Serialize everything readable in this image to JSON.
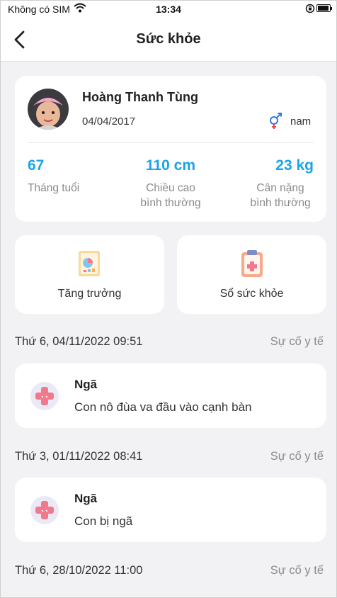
{
  "status_bar": {
    "carrier": "Không có SIM",
    "time": "13:34",
    "battery_level": 0.95
  },
  "header": {
    "title": "Sức khỏe"
  },
  "profile": {
    "name": "Hoàng Thanh Tùng",
    "dob": "04/04/2017",
    "gender": "nam",
    "stats": [
      {
        "value": "67",
        "label_line1": "Tháng tuổi",
        "label_line2": ""
      },
      {
        "value": "110 cm",
        "label_line1": "Chiều cao",
        "label_line2": "bình thường"
      },
      {
        "value": "23 kg",
        "label_line1": "Cân nặng",
        "label_line2": "bình thường"
      }
    ]
  },
  "quick_actions": [
    {
      "label": "Tăng trưởng",
      "icon": "growth-chart-icon"
    },
    {
      "label": "Sổ sức khỏe",
      "icon": "health-book-icon"
    }
  ],
  "events": [
    {
      "date": "Thứ 6, 04/11/2022 09:51",
      "type": "Sự cố y tế",
      "title": "Ngã",
      "description": "Con nô đùa va đầu vào cạnh bàn",
      "icon": "bandage-icon"
    },
    {
      "date": "Thứ 3, 01/11/2022 08:41",
      "type": "Sự cố y tế",
      "title": "Ngã",
      "description": "Con bị ngã",
      "icon": "bandage-icon"
    },
    {
      "date": "Thứ 6, 28/10/2022 11:00",
      "type": "Sự cố y tế"
    }
  ],
  "colors": {
    "accent": "#1aa3e8",
    "background": "#f2f2f4",
    "card": "#ffffff",
    "muted_text": "#8a8a8a",
    "gender_icon": "#e84a4a"
  }
}
